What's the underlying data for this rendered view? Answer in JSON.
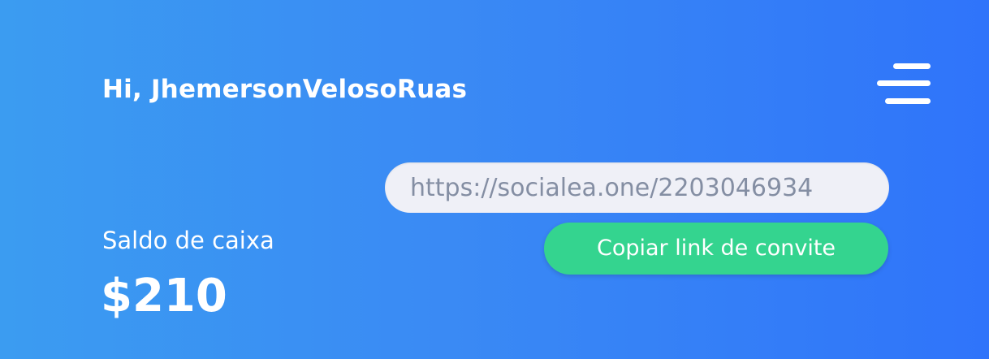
{
  "header": {
    "greeting": "Hi, JhemersonVelosoRuas",
    "menu_icon": "hamburger-menu-icon"
  },
  "balance": {
    "label": "Saldo de caixa",
    "value": "$210"
  },
  "invite": {
    "link": "https://socialea.one/2203046934",
    "copy_label": "Copiar link de convite"
  },
  "colors": {
    "background_start": "#3b9cf1",
    "background_end": "#2f74fa",
    "button": "#34d48f",
    "field_background": "#eff0f7",
    "field_text": "#848ea3",
    "text": "#ffffff"
  }
}
